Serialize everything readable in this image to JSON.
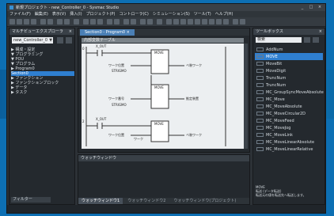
{
  "window": {
    "title": "新規プロジェクト - new_Controller_0 - Sysmac Studio",
    "btn_min": "_",
    "btn_max": "□",
    "btn_close": "×"
  },
  "menu": [
    "ファイル(F)",
    "編集(E)",
    "表示(V)",
    "挿入(I)",
    "プロジェクト(P)",
    "コントローラ(C)",
    "シミュレーション(S)",
    "ツール(T)",
    "ヘルプ(H)"
  ],
  "left": {
    "title": "マルチビューエクスプローラ",
    "close": "×",
    "combo": "new_Controller_0",
    "combo_arrow": "▼",
    "tree": [
      {
        "label": "▶ 構成・設定",
        "sel": false
      },
      {
        "label": "▼ プログラミング",
        "sel": false
      },
      {
        "label": "  ▼ POU",
        "sel": false
      },
      {
        "label": "    ▼ プログラム",
        "sel": false
      },
      {
        "label": "      ▶ Program0",
        "sel": false
      },
      {
        "label": "        Section0",
        "sel": true
      },
      {
        "label": "    ▶ ファンクション",
        "sel": false
      },
      {
        "label": "    ▶ ファンクションブロック",
        "sel": false
      },
      {
        "label": "  ▶ データ",
        "sel": false
      },
      {
        "label": "  ▶ タスク",
        "sel": false
      }
    ],
    "bottom": "フィルター"
  },
  "editor": {
    "tab": "Section0 - Program0 ×",
    "var_header": "内部変数テーブル",
    "rungs": [
      {
        "num": "0",
        "contact": "X_OUT",
        "in_label": "ワーク位置",
        "in_label2": "STRIGMO",
        "fb": "MOVE",
        "out": "ベ装ワーク"
      },
      {
        "num": "",
        "contact": "",
        "in_label": "ワーク番号",
        "in_label2": "STRIGMO",
        "fb": "MOVE",
        "out": "推定装置"
      },
      {
        "num": "2",
        "contact": "X_OUT",
        "in_label": "ワーク位置",
        "in_label2": "ワーク",
        "fb": "MOVE",
        "out": "ベ装ワーク"
      }
    ]
  },
  "output": {
    "title": "ウォッチウィンドウ",
    "tabs": [
      "ウォッチウィンドウ1",
      "ウォッチウィンドウ2",
      "ウォッチウィンドウ(プロジェクト)"
    ]
  },
  "toolbox": {
    "title": "ツールボックス",
    "close": "×",
    "search_placeholder": "検索",
    "items": [
      {
        "label": "AddNum",
        "sel": false
      },
      {
        "label": "MOVE",
        "sel": true
      },
      {
        "label": "MoveBit",
        "sel": false
      },
      {
        "label": "MoveDigit",
        "sel": false
      },
      {
        "label": "TruncNum",
        "sel": false
      },
      {
        "label": "TruncNum",
        "sel": false
      },
      {
        "label": "MC_GroupSyncMoveAbsolute",
        "sel": false
      },
      {
        "label": "MC_Move",
        "sel": false
      },
      {
        "label": "MC_MoveAbsolute",
        "sel": false
      },
      {
        "label": "MC_MoveCircular2D",
        "sel": false
      },
      {
        "label": "MC_MoveFeed",
        "sel": false
      },
      {
        "label": "MC_MoveJog",
        "sel": false
      },
      {
        "label": "MC_MoveLink",
        "sel": false
      },
      {
        "label": "MC_MoveLinearAbsolute",
        "sel": false
      },
      {
        "label": "MC_MoveLinearRelative",
        "sel": false
      }
    ],
    "desc_title": "MOVE",
    "desc": "転送 (データ転送)\n転送元の値を転送先へ転送します。"
  },
  "colors": {
    "accent": "#2f7fd0",
    "background": "#0d6fb3",
    "ladder_bg": "#eceff1"
  }
}
